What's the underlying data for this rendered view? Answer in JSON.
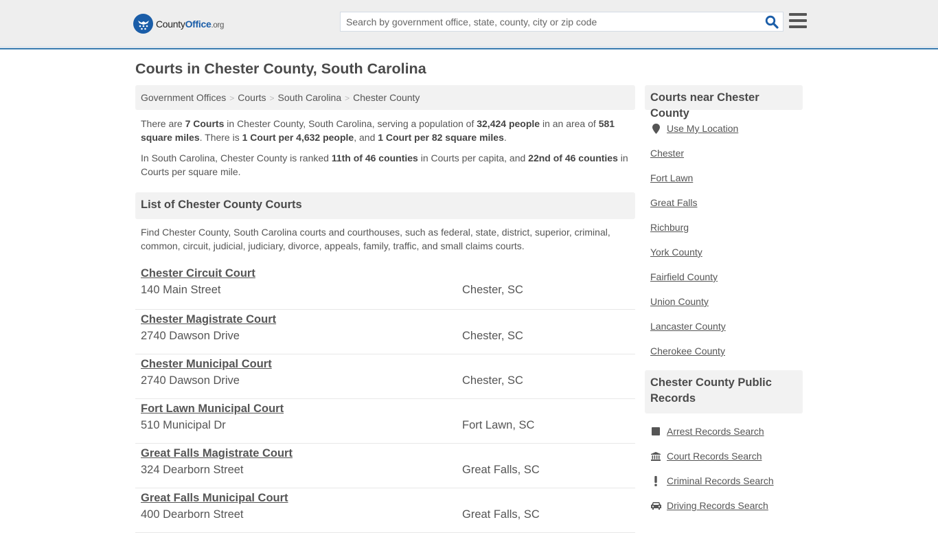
{
  "header": {
    "logo": {
      "name_part1": "County",
      "name_part2": "Office",
      "name_part3": ".org"
    },
    "search": {
      "placeholder": "Search by government office, state, county, city or zip code",
      "value": ""
    },
    "icons": {
      "search": "search-icon",
      "menu": "hamburger-menu-icon"
    }
  },
  "page": {
    "title": "Courts in Chester County, South Carolina"
  },
  "breadcrumb": [
    {
      "label": "Government Offices"
    },
    {
      "label": "Courts"
    },
    {
      "label": "South Carolina"
    },
    {
      "label": "Chester County"
    }
  ],
  "summary": {
    "p1": {
      "t1": "There are ",
      "b1": "7 Courts",
      "t2": " in Chester County, South Carolina, serving a population of ",
      "b2": "32,424 people",
      "t3": " in an area of ",
      "b3": "581 square miles",
      "t4": ". There is ",
      "b4": "1 Court per 4,632 people",
      "t5": ", and ",
      "b5": "1 Court per 82 square miles",
      "t6": "."
    },
    "p2": {
      "t1": "In South Carolina, Chester County is ranked ",
      "b1": "11th of 46 counties",
      "t2": " in Courts per capita, and ",
      "b2": "22nd of 46 counties",
      "t3": " in Courts per square mile."
    }
  },
  "list_section": {
    "heading": "List of Chester County Courts",
    "description": "Find Chester County, South Carolina courts and courthouses, such as federal, state, district, superior, criminal, common, circuit, judicial, judiciary, divorce, appeals, family, traffic, and small claims courts.",
    "courts": [
      {
        "name": "Chester Circuit Court",
        "address": "140 Main Street",
        "city": "Chester, SC"
      },
      {
        "name": "Chester Magistrate Court",
        "address": "2740 Dawson Drive",
        "city": "Chester, SC"
      },
      {
        "name": "Chester Municipal Court",
        "address": "2740 Dawson Drive",
        "city": "Chester, SC"
      },
      {
        "name": "Fort Lawn Municipal Court",
        "address": "510 Municipal Dr",
        "city": "Fort Lawn, SC"
      },
      {
        "name": "Great Falls Magistrate Court",
        "address": "324 Dearborn Street",
        "city": "Great Falls, SC"
      },
      {
        "name": "Great Falls Municipal Court",
        "address": "400 Dearborn Street",
        "city": "Great Falls, SC"
      }
    ]
  },
  "sidebar": {
    "near": {
      "heading": "Courts near Chester County",
      "use_location": {
        "label": "Use My Location",
        "icon": "map-marker-icon"
      },
      "links": [
        {
          "label": "Chester"
        },
        {
          "label": "Fort Lawn"
        },
        {
          "label": "Great Falls"
        },
        {
          "label": "Richburg"
        },
        {
          "label": "York County"
        },
        {
          "label": "Fairfield County"
        },
        {
          "label": "Union County"
        },
        {
          "label": "Lancaster County"
        },
        {
          "label": "Cherokee County"
        }
      ]
    },
    "records": {
      "heading": "Chester County Public Records",
      "links": [
        {
          "label": "Arrest Records Search",
          "icon": "square-icon"
        },
        {
          "label": "Court Records Search",
          "icon": "courthouse-icon"
        },
        {
          "label": "Criminal Records Search",
          "icon": "exclamation-icon"
        },
        {
          "label": "Driving Records Search",
          "icon": "car-icon"
        }
      ]
    }
  },
  "colors": {
    "brand_blue": "#1a5da8",
    "header_bg": "#eeeeee",
    "header_border": "#3a7cb0",
    "panel_bg": "#f2f2f2",
    "text": "#555555"
  }
}
